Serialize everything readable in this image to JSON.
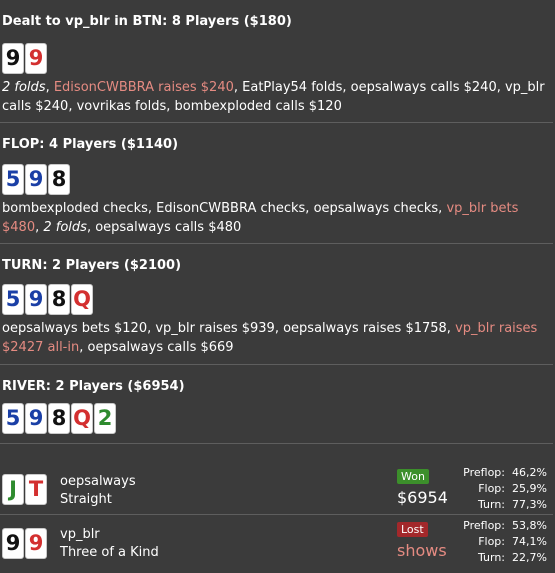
{
  "preflop": {
    "header": "Dealt to vp_blr in BTN: 8 Players ($180)",
    "cards": [
      {
        "rank": "9",
        "color": "#111111"
      },
      {
        "rank": "9",
        "color": "#d32f2f"
      }
    ],
    "actions": [
      {
        "text": "2 folds",
        "style": "it"
      },
      {
        "text": ", ",
        "style": ""
      },
      {
        "text": "EdisonCWBBRA raises $240",
        "style": "red"
      },
      {
        "text": ", EatPlay54 folds, oepsalways calls $240, vp_blr calls $240, vovrikas folds, bombexploded calls $120",
        "style": ""
      }
    ]
  },
  "flop": {
    "header": "FLOP: 4 Players ($1140)",
    "cards": [
      {
        "rank": "5",
        "color": "#1a3fa6"
      },
      {
        "rank": "9",
        "color": "#1a3fa6"
      },
      {
        "rank": "8",
        "color": "#111111"
      }
    ],
    "actions": [
      {
        "text": "bombexploded checks, EdisonCWBBRA checks, oepsalways checks, ",
        "style": ""
      },
      {
        "text": "vp_blr bets $480",
        "style": "red"
      },
      {
        "text": ", ",
        "style": ""
      },
      {
        "text": "2 folds",
        "style": "it"
      },
      {
        "text": ", oepsalways calls $480",
        "style": ""
      }
    ]
  },
  "turn": {
    "header": "TURN: 2 Players ($2100)",
    "cards": [
      {
        "rank": "5",
        "color": "#1a3fa6"
      },
      {
        "rank": "9",
        "color": "#1a3fa6"
      },
      {
        "rank": "8",
        "color": "#111111"
      },
      {
        "rank": "Q",
        "color": "#d32f2f"
      }
    ],
    "actions": [
      {
        "text": "oepsalways bets $120, vp_blr raises $939, oepsalways raises $1758, ",
        "style": ""
      },
      {
        "text": "vp_blr raises $2427 all-in",
        "style": "red"
      },
      {
        "text": ", oepsalways calls $669",
        "style": ""
      }
    ]
  },
  "river": {
    "header": "RIVER: 2 Players ($6954)",
    "cards": [
      {
        "rank": "5",
        "color": "#1a3fa6"
      },
      {
        "rank": "9",
        "color": "#1a3fa6"
      },
      {
        "rank": "8",
        "color": "#111111"
      },
      {
        "rank": "Q",
        "color": "#d32f2f"
      },
      {
        "rank": "2",
        "color": "#2e8b2e"
      }
    ]
  },
  "players": [
    {
      "name": "oepsalways",
      "hand": "Straight",
      "cards": [
        {
          "rank": "J",
          "color": "#2e8b2e"
        },
        {
          "rank": "T",
          "color": "#d32f2f"
        }
      ],
      "badge": "Won",
      "badge_color": "#3c8f2b",
      "result": "$6954",
      "result_color": "#ffffff",
      "stats": [
        {
          "label": "Preflop:",
          "value": "46,2%"
        },
        {
          "label": "Flop:",
          "value": "25,9%"
        },
        {
          "label": "Turn:",
          "value": "77,3%"
        }
      ]
    },
    {
      "name": "vp_blr",
      "hand": "Three of a Kind",
      "cards": [
        {
          "rank": "9",
          "color": "#111111"
        },
        {
          "rank": "9",
          "color": "#d32f2f"
        }
      ],
      "badge": "Lost",
      "badge_color": "#a3282b",
      "result": "shows",
      "result_color": "#e58b82",
      "stats": [
        {
          "label": "Preflop:",
          "value": "53,8%"
        },
        {
          "label": "Flop:",
          "value": "74,1%"
        },
        {
          "label": "Turn:",
          "value": "22,7%"
        }
      ]
    }
  ]
}
